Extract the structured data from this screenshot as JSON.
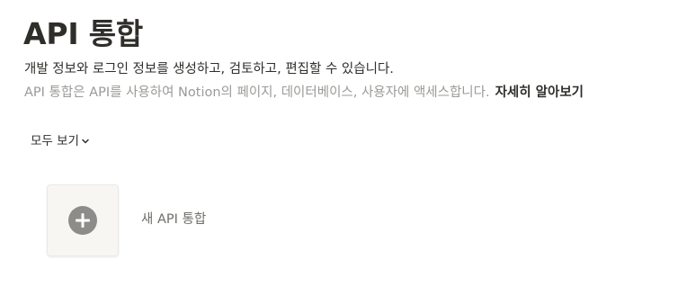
{
  "page": {
    "title": "API 통합",
    "description": "개발 정보와 로그인 정보를 생성하고, 검토하고, 편집할 수 있습니다.",
    "subdescription": "API 통합은 API를 사용하여 Notion의 페이지, 데이터베이스, 사용자에 액세스합니다.",
    "learn_more": "자세히 알아보기"
  },
  "filter": {
    "label": "모두 보기",
    "icon": "chevron-down-icon"
  },
  "new_integration": {
    "label": "새 API 통합",
    "icon": "plus-circle-icon"
  },
  "colors": {
    "text": "#2f2e2b",
    "muted": "#9b9a97",
    "card_bg": "#f7f6f3",
    "icon_gray": "#8d8c89"
  }
}
